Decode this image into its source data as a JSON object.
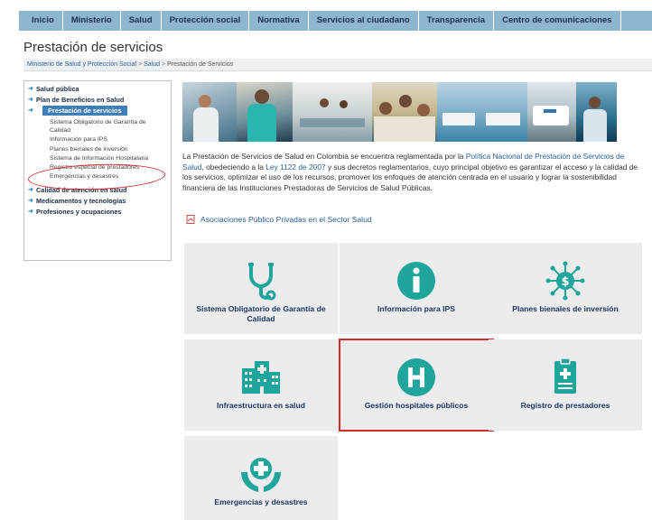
{
  "nav": {
    "items": [
      "Inicio",
      "Ministerio",
      "Salud",
      "Protección social",
      "Normativa",
      "Servicios al ciudadano",
      "Transparencia",
      "Centro de comunicaciones"
    ]
  },
  "page": {
    "title": "Prestación de servicios"
  },
  "breadcrumb": {
    "items": [
      "Ministerio de Salud y Protección Social",
      "Salud",
      "Prestación de Servicios"
    ],
    "separator": ">"
  },
  "sidebar": {
    "items": [
      {
        "label": "Salud pública"
      },
      {
        "label": "Plan de Beneficios en Salud"
      },
      {
        "label": "Prestación de servicios",
        "active": true
      },
      {
        "label": "Calidad de atención en salud"
      },
      {
        "label": "Medicamentos y tecnologías"
      },
      {
        "label": "Profesiones y ocupaciones"
      }
    ],
    "subitems": [
      "Sistema Obligatorio de Garantía de Calidad",
      "Información para IPS",
      "Planes bienales de inversión",
      "Sistema de Información Hospitalaria",
      "Registro especial de prestadores",
      "Emergencias y desastres"
    ]
  },
  "intro": {
    "p1": "La Prestación de Servicios de Salud en Colombia se encuentra reglamentada por la ",
    "link1": "Política Nacional de Prestación de Servicios de Salud",
    "p2": ", obedeciendo a la ",
    "link2": "Ley 1122 de 2007",
    "p3": " y sus decretos reglamentarios, cuyo principal objetivo es garantizar el acceso y la calidad de los servicios, optimizar el uso de los recursos, promover los enfoques de atención centrada en el usuario y lograr la sostenibilidad financiera de las Instituciones Prestadoras de Servicios de Salud Públicas."
  },
  "assoc_link": "Asociaciones Público Privadas en el Sector Salud",
  "tiles": [
    {
      "label": "Sistema Obligatorio de Garantía de Calidad",
      "icon": "stethoscope-icon"
    },
    {
      "label": "Información para IPS",
      "icon": "info-icon"
    },
    {
      "label": "Planes bienales de inversión",
      "icon": "money-network-icon"
    },
    {
      "label": "Infraestructura en salud",
      "icon": "buildings-icon"
    },
    {
      "label": "Gestión hospitales públicos",
      "icon": "hospital-h-icon",
      "highlighted": true
    },
    {
      "label": "Registro de prestadores",
      "icon": "clipboard-icon"
    },
    {
      "label": "Emergencias y desastres",
      "icon": "hands-cross-icon"
    }
  ],
  "colors": {
    "nav_bg": "#8fb6cf",
    "accent_teal": "#1fa59b",
    "link": "#2b5f96",
    "tile_label": "#1c3564",
    "highlight": "#d42b2b"
  }
}
